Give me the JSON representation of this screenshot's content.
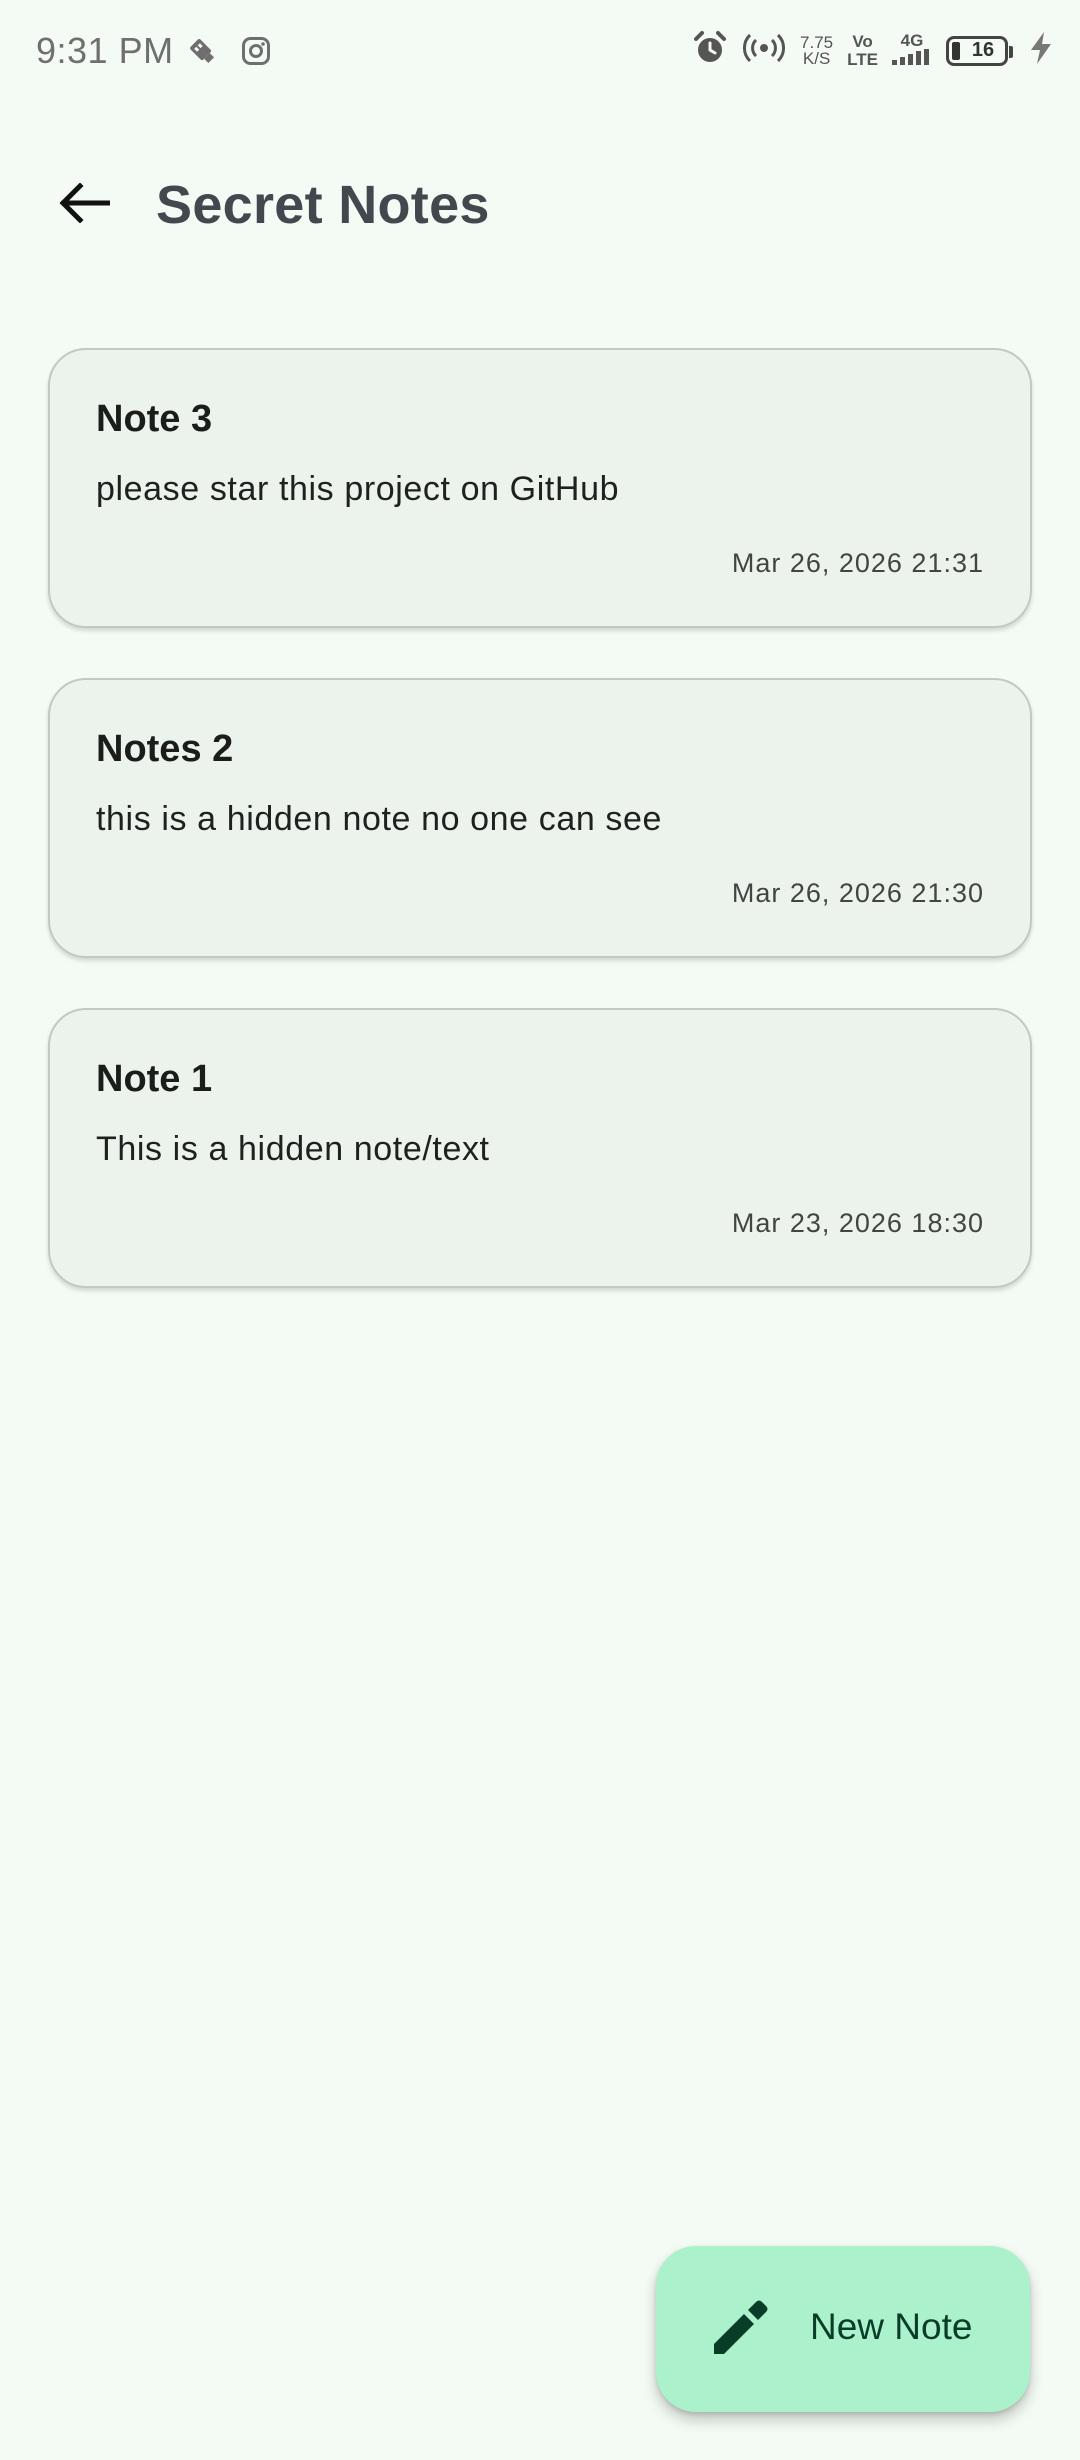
{
  "status_bar": {
    "time": "9:31 PM",
    "net_speed_value": "7.75",
    "net_speed_unit": "K/S",
    "volte_top": "Vo",
    "volte_bottom": "LTE",
    "network_type": "4G",
    "battery_level": "16",
    "icons": [
      "usb-debug-icon",
      "instagram-icon",
      "alarm-icon",
      "hotspot-icon",
      "signal-icon",
      "battery-icon",
      "charging-icon"
    ]
  },
  "app_bar": {
    "back_icon": "arrow-back-icon",
    "title": "Secret Notes"
  },
  "notes": [
    {
      "title": "Note 3",
      "body": "please star this project on GitHub",
      "date": "Mar 26, 2026 21:31"
    },
    {
      "title": "Notes 2",
      "body": "this is a hidden note no one can see",
      "date": "Mar 26, 2026 21:30"
    },
    {
      "title": "Note 1",
      "body": "This is a hidden note/text",
      "date": "Mar 23, 2026 18:30"
    }
  ],
  "fab": {
    "icon": "pencil-icon",
    "label": "New Note"
  },
  "colors": {
    "background": "#f4fbf4",
    "card": "#ecf3ec",
    "card_border": "#c4c8c4",
    "title_text": "#43474e",
    "fab_background": "#abf2cc",
    "fab_foreground": "#0a3d28"
  }
}
